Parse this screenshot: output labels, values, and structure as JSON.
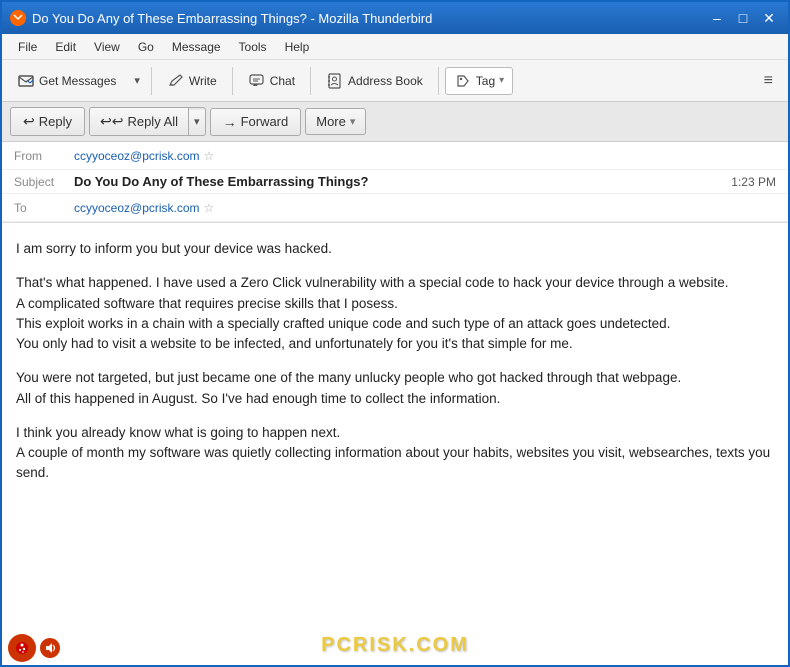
{
  "window": {
    "title": "Do You Do Any of These Embarrassing Things? - Mozilla Thunderbird",
    "icon": "🔥"
  },
  "title_controls": {
    "minimize": "–",
    "maximize": "□",
    "close": "✕"
  },
  "menu_bar": {
    "items": [
      "File",
      "Edit",
      "View",
      "Go",
      "Message",
      "Tools",
      "Help"
    ]
  },
  "toolbar": {
    "get_messages_label": "Get Messages",
    "write_label": "Write",
    "chat_label": "Chat",
    "address_book_label": "Address Book",
    "tag_label": "Tag",
    "menu_icon": "≡"
  },
  "action_bar": {
    "reply_label": "Reply",
    "reply_all_label": "Reply All",
    "forward_label": "Forward",
    "more_label": "More"
  },
  "email_header": {
    "from_label": "From",
    "from_value": "ccyyoceoz@pcrisk.com",
    "subject_label": "Subject",
    "subject_value": "Do You Do Any of These Embarrassing Things?",
    "time_value": "1:23 PM",
    "to_label": "To",
    "to_value": "ccyyoceoz@pcrisk.com"
  },
  "email_body": {
    "paragraphs": [
      "I am sorry to inform you but your device was hacked.",
      "That's what happened. I have used a Zero Click vulnerability with a special code to hack your device through a website.\nA complicated software that requires precise skills that I posess.\nThis exploit works in a chain with a specially crafted unique code and such type of an attack goes undetected.\nYou only had to visit a website to be infected, and unfortunately for you it's that simple for me.",
      "You were not targeted, but just became one of the many unlucky people who got hacked through that webpage.\nAll of this happened in August. So I've had enough time to collect the information.",
      "I think you already know what is going to happen next.\nA couple of month my software was quietly collecting information about your habits, websites you visit, websearches, texts you send."
    ]
  },
  "watermark": {
    "text": "PCRISK.COM"
  }
}
